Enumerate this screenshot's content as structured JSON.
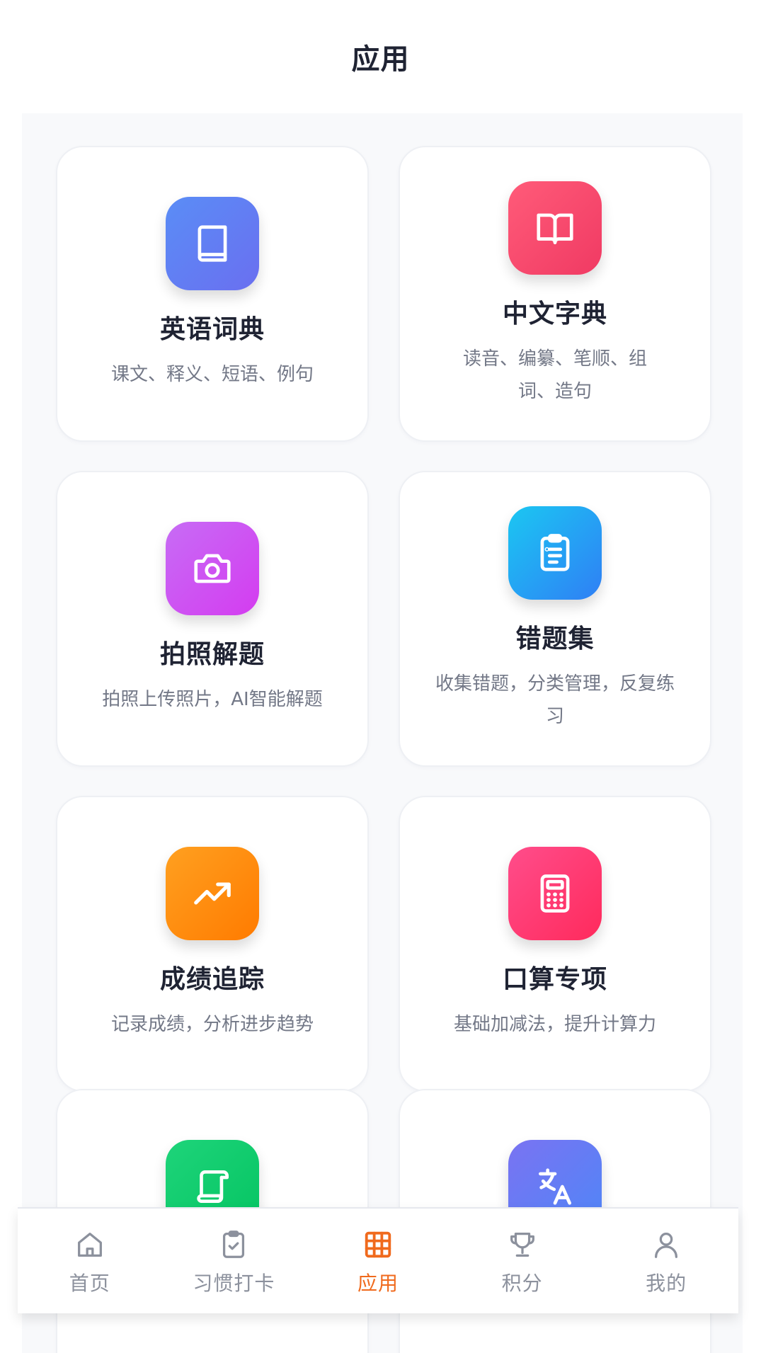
{
  "header": {
    "title": "应用"
  },
  "cards": [
    {
      "title": "英语词典",
      "desc": "课文、释义、短语、例句",
      "icon": "book-icon",
      "gradient": [
        "#5a8df6",
        "#6a6ff0"
      ]
    },
    {
      "title": "中文字典",
      "desc": "读音、编纂、笔顺、组词、造句",
      "icon": "open-book-icon",
      "gradient": [
        "#ff5b79",
        "#f03a63"
      ]
    },
    {
      "title": "拍照解题",
      "desc": "拍照上传照片，AI智能解题",
      "icon": "camera-icon",
      "gradient": [
        "#c76cf5",
        "#d43cf0"
      ]
    },
    {
      "title": "错题集",
      "desc": "收集错题，分类管理，反复练习",
      "icon": "clipboard-icon",
      "gradient": [
        "#1bc7f2",
        "#2f7ff5"
      ]
    },
    {
      "title": "成绩追踪",
      "desc": "记录成绩，分析进步趋势",
      "icon": "trending-up-icon",
      "gradient": [
        "#ffa020",
        "#ff7b00"
      ]
    },
    {
      "title": "口算专项",
      "desc": "基础加减法，提升计算力",
      "icon": "calculator-icon",
      "gradient": [
        "#ff4d8b",
        "#ff2a5c"
      ]
    },
    {
      "title": "",
      "desc": "",
      "icon": "scroll-icon",
      "gradient": [
        "#1ed47a",
        "#05c462"
      ]
    },
    {
      "title": "",
      "desc": "",
      "icon": "translate-icon",
      "gradient": [
        "#7a73f2",
        "#4f86f7"
      ]
    }
  ],
  "tabbar": {
    "items": [
      {
        "label": "首页",
        "icon": "home-icon",
        "active": false
      },
      {
        "label": "习惯打卡",
        "icon": "clipboard-check-icon",
        "active": false
      },
      {
        "label": "应用",
        "icon": "grid-icon",
        "active": true
      },
      {
        "label": "积分",
        "icon": "trophy-icon",
        "active": false
      },
      {
        "label": "我的",
        "icon": "user-icon",
        "active": false
      }
    ],
    "active_color": "#f06a1d",
    "inactive_color": "#8c919d"
  }
}
